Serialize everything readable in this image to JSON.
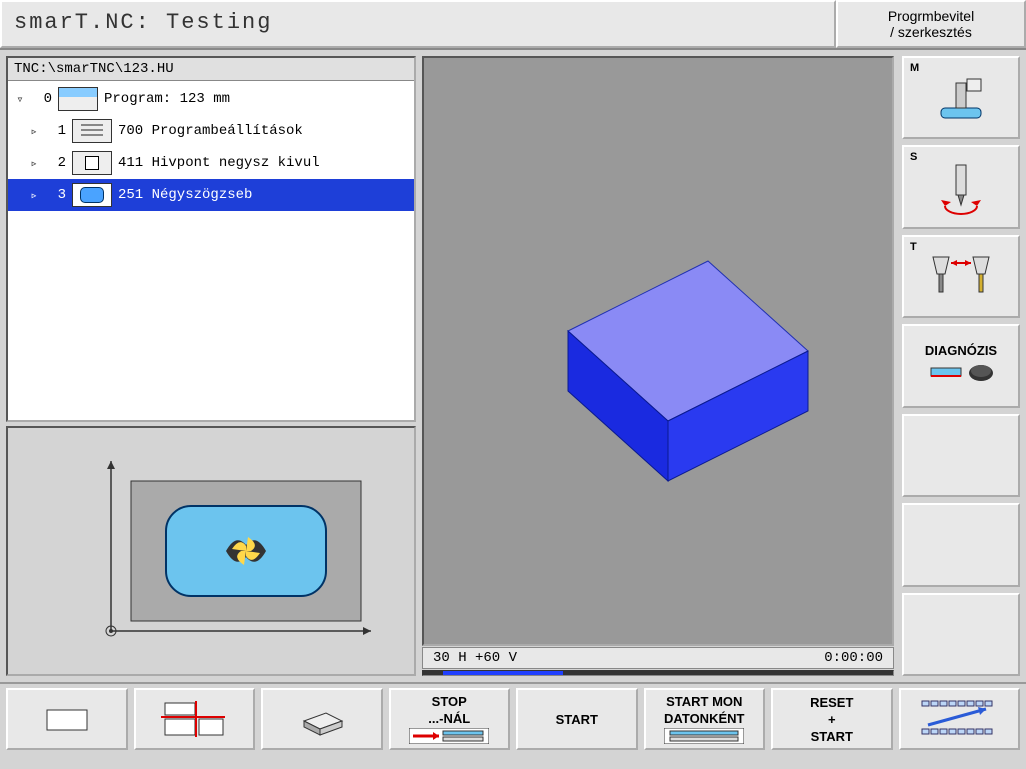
{
  "header": {
    "title": "smarT.NC: Testing",
    "mode_line1": "Progrmbevitel",
    "mode_line2": "/ szerkesztés"
  },
  "tree": {
    "path": "TNC:\\smarTNC\\123.HU",
    "rows": [
      {
        "toggle": "▿",
        "num": "0",
        "icon": "prog",
        "text": "Program: 123 mm",
        "selected": false
      },
      {
        "toggle": "▹",
        "num": "1",
        "icon": "settings",
        "text": "700 Programbeállítások",
        "selected": false
      },
      {
        "toggle": "▹",
        "num": "2",
        "icon": "datum",
        "text": "411 Hivpont negysz kivul",
        "selected": false
      },
      {
        "toggle": "▹",
        "num": "3",
        "icon": "pocket",
        "text": "251 Négyszögzseb",
        "selected": true
      }
    ]
  },
  "status": {
    "coords": "30 H +60 V",
    "time": "0:00:00"
  },
  "side_buttons": {
    "m": "M",
    "s": "S",
    "t": "T",
    "diag": "DIAGNÓZIS"
  },
  "bottom": {
    "stop_l1": "STOP",
    "stop_l2": "...-NÁL",
    "start": "START",
    "startmon_l1": "START MON",
    "startmon_l2": "DATONKÉNT",
    "reset_l1": "RESET",
    "reset_l2": "+",
    "reset_l3": "START"
  }
}
